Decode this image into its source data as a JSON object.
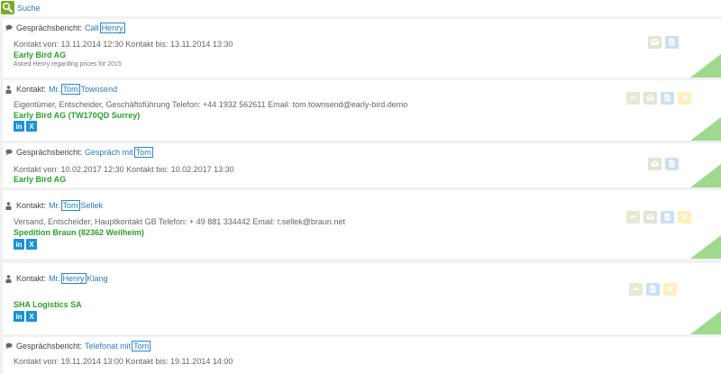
{
  "search": {
    "label": "Suche"
  },
  "cards": [
    {
      "prefix": "Gesprächsbericht:",
      "link_before": "Call",
      "highlight": "Henry",
      "link_after": "",
      "meta": "Kontakt von: 13.11.2014 12:30   Kontakt bis: 13.11.2014 13:30",
      "company": "Early Bird AG",
      "note": "Asked Henry regarding prices for 2015"
    },
    {
      "prefix": "Kontakt:",
      "link_before": "Mr.",
      "highlight": "Tom",
      "link_after": "Townsend",
      "meta": "Eigentümer, Entscheider, Geschäftsführung Telefon: +44 1932 562611   Email: tom.townsend@early-bird.demo",
      "company": "Early Bird AG (TW170QD Surrey)",
      "social": [
        "in",
        "X"
      ]
    },
    {
      "prefix": "Gesprächsbericht:",
      "link_before": "Gespräch mit",
      "highlight": "Tom",
      "link_after": "",
      "meta": "Kontakt von: 10.02.2017 12:30   Kontakt bis: 10.02.2017 13:30",
      "company": "Early Bird AG"
    },
    {
      "prefix": "Kontakt:",
      "link_before": "Mr.",
      "highlight": "Tom",
      "link_after": "Sellek",
      "meta": "Versand, Entscheider, Hauptkontakt GB Telefon: + 49 881 334442   Email: t.sellek@braun.net",
      "company": "Spedition Braun (82362 Weilheim)",
      "social": [
        "in",
        "X"
      ]
    },
    {
      "prefix": "Kontakt:",
      "link_before": "Mr.",
      "highlight": "Henry",
      "link_after": "Klang",
      "meta": "",
      "company": "SHA Logistics SA",
      "social": [
        "in",
        "X"
      ]
    },
    {
      "prefix": "Gesprächsbericht:",
      "link_before": "Telefonat mit",
      "highlight": "Tom",
      "link_after": "",
      "meta": "Kontakt von: 19.11.2014 13:00   Kontakt bis: 19.11.2014 14:00"
    }
  ],
  "colors": {
    "link": "#2a7ab8",
    "company": "#2ca02c",
    "highlight_border": "#2a89d4",
    "corner": "#9fd98e",
    "social": "#1a94d6"
  }
}
